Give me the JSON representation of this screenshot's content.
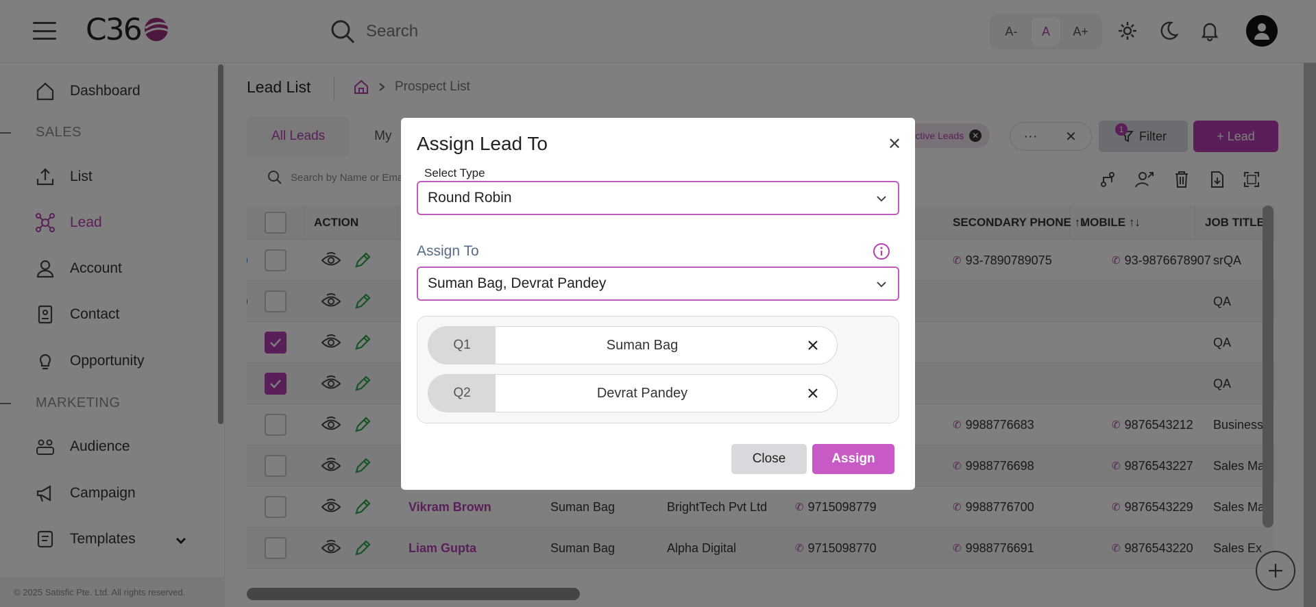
{
  "header": {
    "logo_text": "C36",
    "search_placeholder": "Search",
    "font_small": "A-",
    "font_normal": "A",
    "font_large": "A+"
  },
  "sidebar": {
    "items": [
      {
        "label": "Dashboard",
        "icon": "home-icon"
      },
      {
        "label": "List",
        "icon": "upload-icon"
      },
      {
        "label": "Lead",
        "icon": "network-icon",
        "active": true
      },
      {
        "label": "Account",
        "icon": "user-icon"
      },
      {
        "label": "Contact",
        "icon": "contact-card-icon"
      },
      {
        "label": "Opportunity",
        "icon": "lightbulb-icon"
      },
      {
        "label": "Audience",
        "icon": "group-icon"
      },
      {
        "label": "Campaign",
        "icon": "megaphone-icon"
      },
      {
        "label": "Templates",
        "icon": "template-icon"
      }
    ],
    "sections": [
      "SALES",
      "MARKETING"
    ],
    "footer": "© 2025 Satisfic Pte. Ltd. All rights reserved."
  },
  "main": {
    "title": "Lead List",
    "breadcrumb_current": "Prospect List",
    "tabs": [
      "All Leads",
      "My"
    ],
    "chip_label": "Active Leads",
    "chip_close": "✕",
    "more_label": "···",
    "clear_label": "✕",
    "filter_label": "Filter",
    "filter_count": "1",
    "add_lead_label": "+ Lead",
    "table_search_placeholder": "Search by Name or Email"
  },
  "table": {
    "headers": [
      "ACTION",
      "SECONDARY PHONE ↑↓",
      "MOBILE ↑↓",
      "JOB TITLE"
    ],
    "rows": [
      {
        "checked": false,
        "schedule": true,
        "name": "",
        "owner": "",
        "company": "",
        "phone": "",
        "secondary": "93-7890789075",
        "mobile": "93-9876678907",
        "job": "srQA"
      },
      {
        "checked": false,
        "schedule": true,
        "name": "",
        "owner": "",
        "company": "",
        "phone": "",
        "secondary": "",
        "mobile": "",
        "job": "QA"
      },
      {
        "checked": true,
        "schedule": false,
        "name": "",
        "owner": "",
        "company": "",
        "phone": "",
        "secondary": "",
        "mobile": "",
        "job": "QA"
      },
      {
        "checked": true,
        "schedule": false,
        "name": "",
        "owner": "",
        "company": "",
        "phone": "",
        "secondary": "",
        "mobile": "",
        "job": "QA"
      },
      {
        "checked": false,
        "schedule": false,
        "name": "",
        "owner": "",
        "company": "",
        "phone": "",
        "secondary": "9988776683",
        "mobile": "9876543212",
        "job": "Business"
      },
      {
        "checked": false,
        "schedule": false,
        "name": "",
        "owner": "",
        "company": "",
        "phone": "",
        "secondary": "9988776698",
        "mobile": "9876543227",
        "job": "Sales Ma"
      },
      {
        "checked": false,
        "schedule": false,
        "name": "Vikram Brown",
        "owner": "Suman Bag",
        "company": "BrightTech Pvt Ltd",
        "phone": "9715098779",
        "secondary": "9988776700",
        "mobile": "9876543229",
        "job": "Sales Ma"
      },
      {
        "checked": false,
        "schedule": false,
        "name": "Liam Gupta",
        "owner": "Suman Bag",
        "company": "Alpha Digital",
        "phone": "9715098770",
        "secondary": "9988776691",
        "mobile": "9876543220",
        "job": "Sales Ex"
      }
    ]
  },
  "modal": {
    "title": "Assign Lead To",
    "close_icon": "✕",
    "select_type_label": "Select Type",
    "select_type_value": "Round Robin",
    "assign_to_label": "Assign To",
    "assign_to_value": "Suman Bag, Devrat Pandey",
    "queue": [
      {
        "label": "Q1",
        "name": "Suman Bag"
      },
      {
        "label": "Q2",
        "name": "Devrat Pandey"
      }
    ],
    "close_button": "Close",
    "assign_button": "Assign"
  },
  "colors": {
    "accent": "#b43fb0",
    "overlay": "rgba(0,0,0,0.5)"
  }
}
